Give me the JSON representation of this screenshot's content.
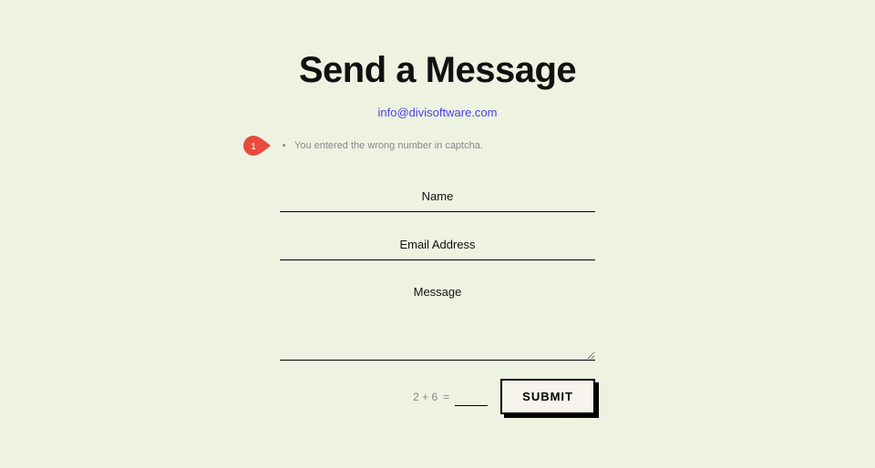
{
  "header": {
    "title": "Send a Message",
    "email": "info@divisoftware.com"
  },
  "annotation": {
    "number": "1"
  },
  "errors": {
    "items": [
      {
        "text": "You entered the wrong number in captcha."
      }
    ]
  },
  "form": {
    "name_placeholder": "Name",
    "email_placeholder": "Email Address",
    "message_placeholder": "Message",
    "captcha_question": "2 + 6",
    "captcha_equals": "=",
    "submit_label": "SUBMIT"
  }
}
